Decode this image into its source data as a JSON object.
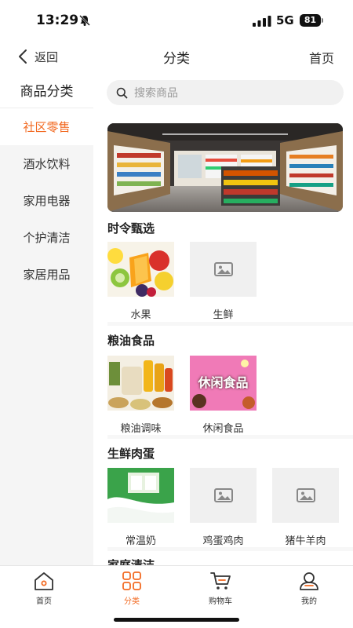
{
  "status_bar": {
    "time": "13:29",
    "network": "5G",
    "battery": "81"
  },
  "nav": {
    "back_label": "返回",
    "title": "分类",
    "home_label": "首页"
  },
  "sidebar": {
    "header": "商品分类",
    "items": [
      {
        "label": "社区零售",
        "active": true
      },
      {
        "label": "酒水饮料"
      },
      {
        "label": "家用电器"
      },
      {
        "label": "个护清洁"
      },
      {
        "label": "家居用品"
      }
    ]
  },
  "search": {
    "placeholder": "搜索商品"
  },
  "sections": [
    {
      "title": "时令甄选",
      "items": [
        {
          "label": "水果"
        },
        {
          "label": "生鲜"
        }
      ]
    },
    {
      "title": "粮油食品",
      "items": [
        {
          "label": "粮油调味"
        },
        {
          "label": "休闲食品",
          "image_text": "休闲食品"
        }
      ]
    },
    {
      "title": "生鲜肉蛋",
      "items": [
        {
          "label": "常温奶"
        },
        {
          "label": "鸡蛋鸡肉"
        },
        {
          "label": "猪牛羊肉"
        }
      ]
    },
    {
      "title": "家庭清洁"
    }
  ],
  "tabbar": {
    "items": [
      {
        "label": "首页"
      },
      {
        "label": "分类",
        "active": true
      },
      {
        "label": "购物车"
      },
      {
        "label": "我的"
      }
    ]
  },
  "colors": {
    "accent": "#f26a22",
    "sidebar_bg": "#f5f5f5"
  }
}
